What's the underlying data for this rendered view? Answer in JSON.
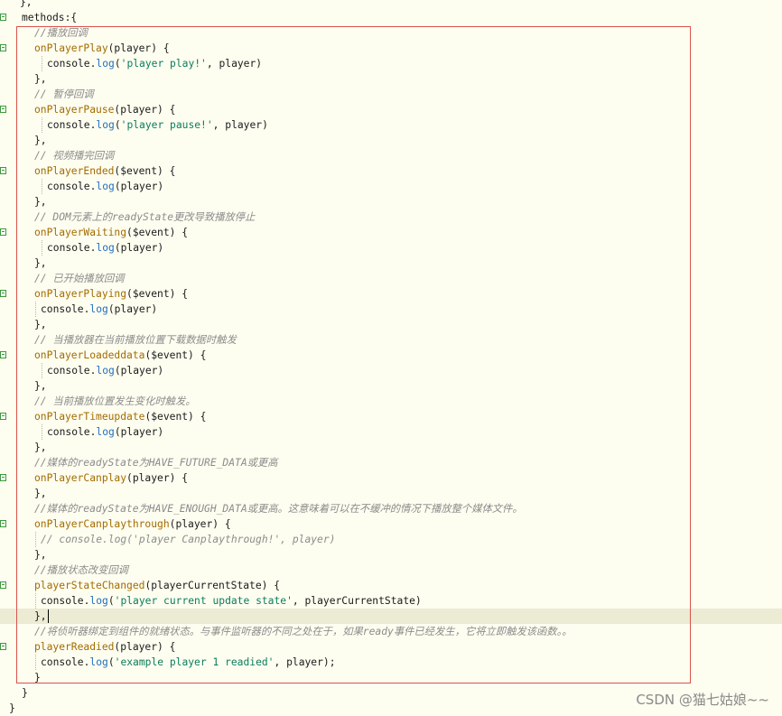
{
  "code": {
    "lines": [
      [
        {
          "t": "},",
          "c": "plain"
        }
      ],
      [
        {
          "t": "methods:{",
          "c": "plain"
        }
      ],
      [
        {
          "t": "//播放回调",
          "c": "comment"
        }
      ],
      [
        {
          "t": "onPlayerPlay",
          "c": "fn"
        },
        {
          "t": "(player) {",
          "c": "plain"
        }
      ],
      [
        {
          "t": "console.",
          "c": "plain"
        },
        {
          "t": "log",
          "c": "log"
        },
        {
          "t": "(",
          "c": "plain"
        },
        {
          "t": "'player play!'",
          "c": "str"
        },
        {
          "t": ", player)",
          "c": "plain"
        }
      ],
      [
        {
          "t": "},",
          "c": "plain"
        }
      ],
      [
        {
          "t": "// 暂停回调",
          "c": "comment"
        }
      ],
      [
        {
          "t": "onPlayerPause",
          "c": "fn"
        },
        {
          "t": "(player) {",
          "c": "plain"
        }
      ],
      [
        {
          "t": "console.",
          "c": "plain"
        },
        {
          "t": "log",
          "c": "log"
        },
        {
          "t": "(",
          "c": "plain"
        },
        {
          "t": "'player pause!'",
          "c": "str"
        },
        {
          "t": ", player)",
          "c": "plain"
        }
      ],
      [
        {
          "t": "},",
          "c": "plain"
        }
      ],
      [
        {
          "t": "// 视频播完回调",
          "c": "comment"
        }
      ],
      [
        {
          "t": "onPlayerEnded",
          "c": "fn"
        },
        {
          "t": "($event) {",
          "c": "plain"
        }
      ],
      [
        {
          "t": "console.",
          "c": "plain"
        },
        {
          "t": "log",
          "c": "log"
        },
        {
          "t": "(player)",
          "c": "plain"
        }
      ],
      [
        {
          "t": "},",
          "c": "plain"
        }
      ],
      [
        {
          "t": "// DOM元素上的readyState更改导致播放停止",
          "c": "comment"
        }
      ],
      [
        {
          "t": "onPlayerWaiting",
          "c": "fn"
        },
        {
          "t": "($event) {",
          "c": "plain"
        }
      ],
      [
        {
          "t": "console.",
          "c": "plain"
        },
        {
          "t": "log",
          "c": "log"
        },
        {
          "t": "(player)",
          "c": "plain"
        }
      ],
      [
        {
          "t": "},",
          "c": "plain"
        }
      ],
      [
        {
          "t": "// 已开始播放回调",
          "c": "comment"
        }
      ],
      [
        {
          "t": "onPlayerPlaying",
          "c": "fn"
        },
        {
          "t": "($event) {",
          "c": "plain"
        }
      ],
      [
        {
          "t": "console.",
          "c": "plain"
        },
        {
          "t": "log",
          "c": "log"
        },
        {
          "t": "(player)",
          "c": "plain"
        }
      ],
      [
        {
          "t": "},",
          "c": "plain"
        }
      ],
      [
        {
          "t": "// 当播放器在当前播放位置下载数据时触发",
          "c": "comment"
        }
      ],
      [
        {
          "t": "onPlayerLoadeddata",
          "c": "fn"
        },
        {
          "t": "($event) {",
          "c": "plain"
        }
      ],
      [
        {
          "t": "console.",
          "c": "plain"
        },
        {
          "t": "log",
          "c": "log"
        },
        {
          "t": "(player)",
          "c": "plain"
        }
      ],
      [
        {
          "t": "},",
          "c": "plain"
        }
      ],
      [
        {
          "t": "// 当前播放位置发生变化时触发。",
          "c": "comment"
        }
      ],
      [
        {
          "t": "onPlayerTimeupdate",
          "c": "fn"
        },
        {
          "t": "($event) {",
          "c": "plain"
        }
      ],
      [
        {
          "t": "console.",
          "c": "plain"
        },
        {
          "t": "log",
          "c": "log"
        },
        {
          "t": "(player)",
          "c": "plain"
        }
      ],
      [
        {
          "t": "},",
          "c": "plain"
        }
      ],
      [
        {
          "t": "//媒体的readyState为HAVE_FUTURE_DATA或更高",
          "c": "comment"
        }
      ],
      [
        {
          "t": "onPlayerCanplay",
          "c": "fn"
        },
        {
          "t": "(player) {",
          "c": "plain"
        }
      ],
      [
        {
          "t": "},",
          "c": "plain"
        }
      ],
      [
        {
          "t": "//媒体的readyState为HAVE_ENOUGH_DATA或更高。这意味着可以在不缓冲的情况下播放整个媒体文件。",
          "c": "comment"
        }
      ],
      [
        {
          "t": "onPlayerCanplaythrough",
          "c": "fn"
        },
        {
          "t": "(player) {",
          "c": "plain"
        }
      ],
      [
        {
          "t": "// console.log('player Canplaythrough!', player)",
          "c": "comment"
        }
      ],
      [
        {
          "t": "},",
          "c": "plain"
        }
      ],
      [
        {
          "t": "//播放状态改变回调",
          "c": "comment"
        }
      ],
      [
        {
          "t": "playerStateChanged",
          "c": "fn"
        },
        {
          "t": "(playerCurrentState) {",
          "c": "plain"
        }
      ],
      [
        {
          "t": "console.",
          "c": "plain"
        },
        {
          "t": "log",
          "c": "log"
        },
        {
          "t": "(",
          "c": "plain"
        },
        {
          "t": "'player current update state'",
          "c": "str"
        },
        {
          "t": ", playerCurrentState)",
          "c": "plain"
        }
      ],
      [
        {
          "t": "},",
          "c": "plain"
        }
      ],
      [
        {
          "t": "//将侦听器绑定到组件的就绪状态。与事件监听器的不同之处在于，如果ready事件已经发生，它将立即触发该函数。。",
          "c": "comment"
        }
      ],
      [
        {
          "t": "playerReadied",
          "c": "fn"
        },
        {
          "t": "(player) {",
          "c": "plain"
        }
      ],
      [
        {
          "t": "console.",
          "c": "plain"
        },
        {
          "t": "log",
          "c": "log"
        },
        {
          "t": "(",
          "c": "plain"
        },
        {
          "t": "'example player 1 readied'",
          "c": "str"
        },
        {
          "t": ", player);",
          "c": "plain"
        }
      ],
      [
        {
          "t": "}",
          "c": "plain"
        }
      ],
      [
        {
          "t": "}",
          "c": "plain"
        }
      ],
      [
        {
          "t": "}",
          "c": "plain"
        }
      ]
    ]
  },
  "watermark": "CSDN @猫七姑娘~~",
  "colors": {
    "comment": "#8c8c8c",
    "function": "#a36c00",
    "string": "#0a7d5c",
    "log": "#1f6fbf",
    "selection_border": "#d9534f",
    "current_line": "#ecebd3"
  }
}
